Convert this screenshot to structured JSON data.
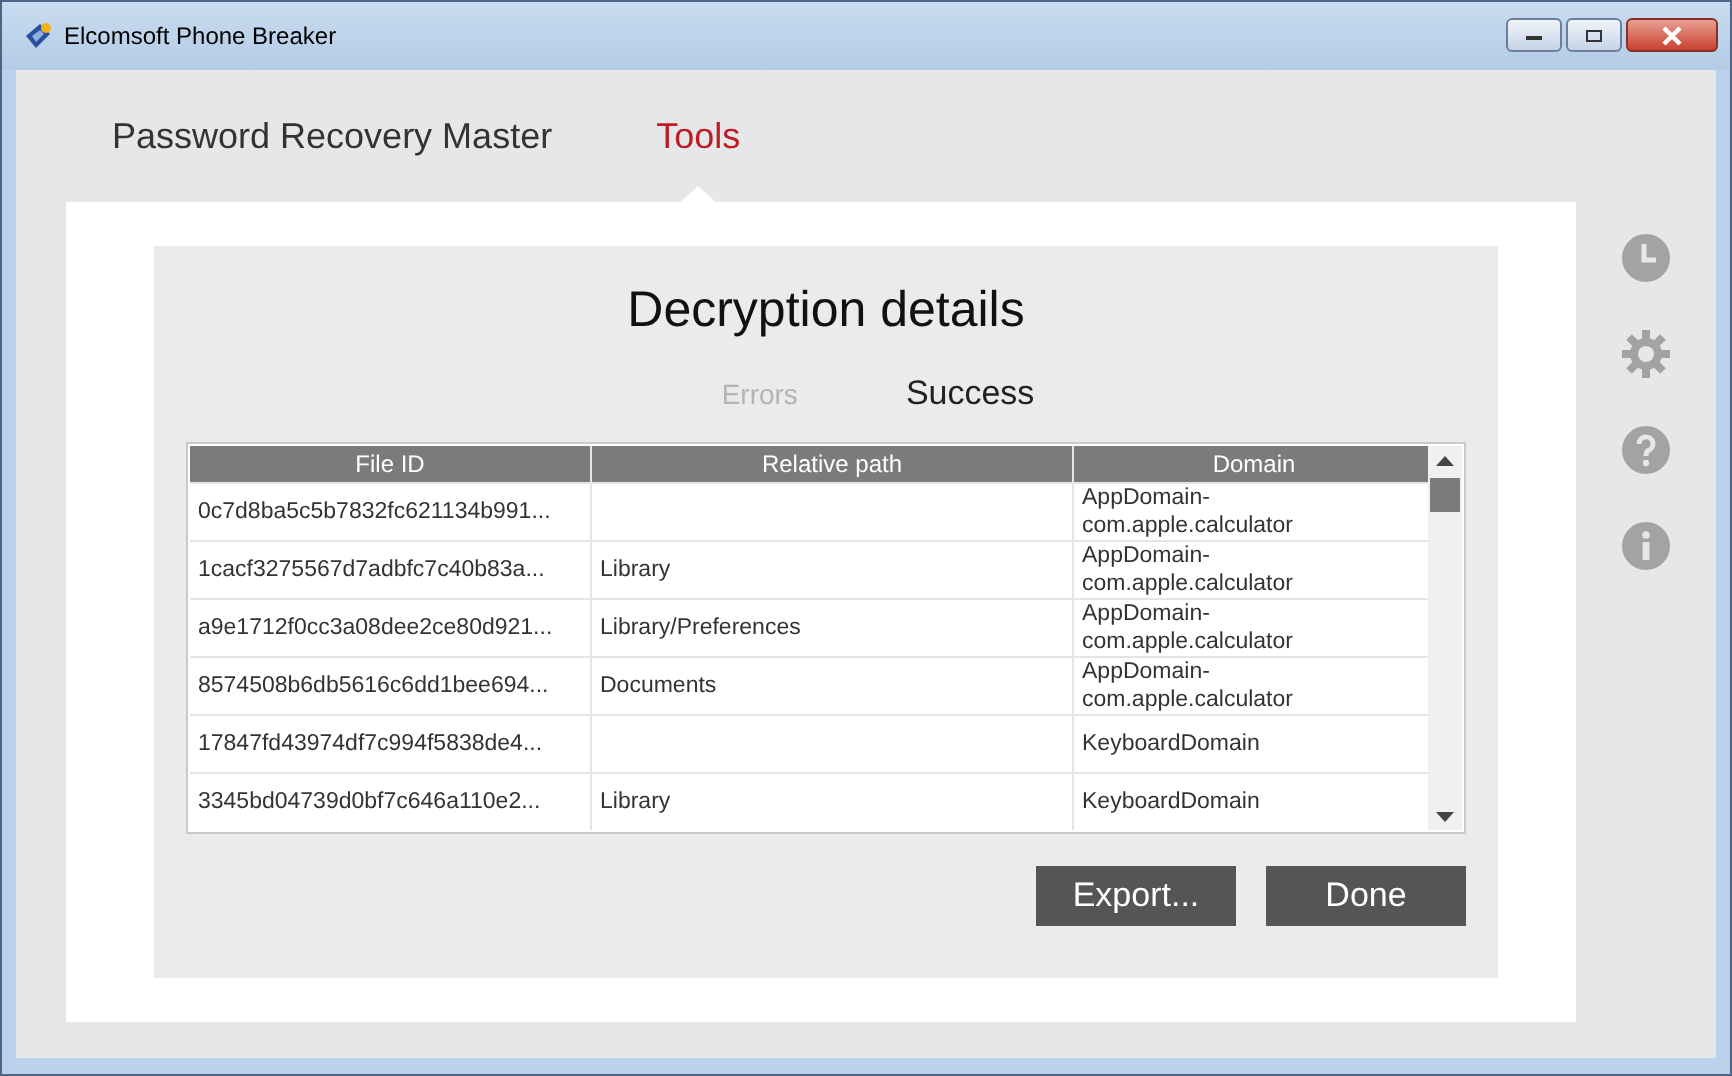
{
  "window": {
    "title": "Elcomsoft Phone Breaker"
  },
  "nav_tabs": [
    {
      "label": "Password Recovery Master",
      "selected": false
    },
    {
      "label": "Tools",
      "selected": true
    }
  ],
  "dialog": {
    "title": "Decryption details",
    "tabs": [
      {
        "label": "Errors",
        "selected": false
      },
      {
        "label": "Success",
        "selected": true
      }
    ],
    "table": {
      "columns": [
        "File ID",
        "Relative path",
        "Domain"
      ],
      "rows": [
        [
          "0c7d8ba5c5b7832fc621134b991...",
          "",
          "AppDomain-com.apple.calculator"
        ],
        [
          "1cacf3275567d7adbfc7c40b83a...",
          "Library",
          "AppDomain-com.apple.calculator"
        ],
        [
          "a9e1712f0cc3a08dee2ce80d921...",
          "Library/Preferences",
          "AppDomain-com.apple.calculator"
        ],
        [
          "8574508b6db5616c6dd1bee694...",
          "Documents",
          "AppDomain-com.apple.calculator"
        ],
        [
          "17847fd43974df7c994f5838de4...",
          "",
          "KeyboardDomain"
        ],
        [
          "3345bd04739d0bf7c646a110e2...",
          "Library",
          "KeyboardDomain"
        ]
      ]
    },
    "buttons": [
      "Export...",
      "Done"
    ]
  }
}
